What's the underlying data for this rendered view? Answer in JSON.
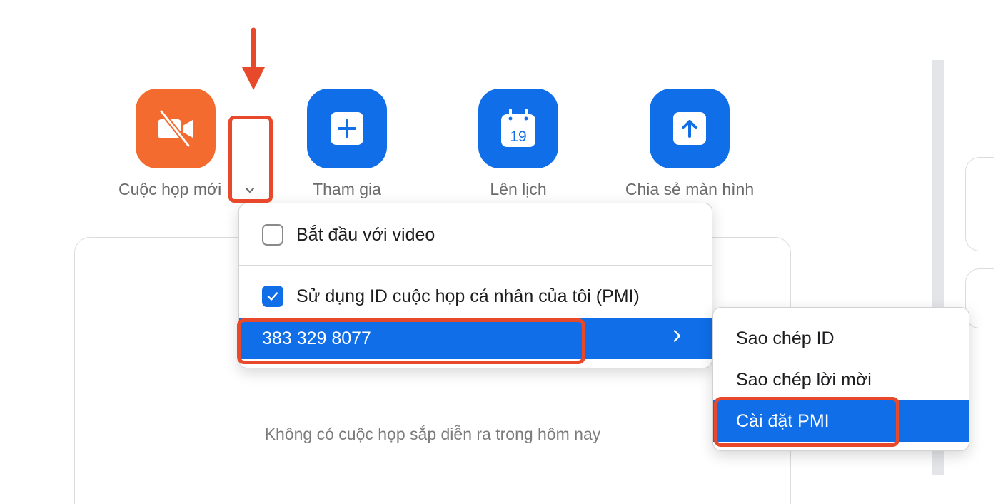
{
  "actions": [
    {
      "id": "new-meeting",
      "label": "Cuộc họp mới",
      "icon": "video-off-icon",
      "color": "#f46b2f"
    },
    {
      "id": "join",
      "label": "Tham gia",
      "icon": "plus-icon",
      "color": "#0f6ee8"
    },
    {
      "id": "schedule",
      "label": "Lên lịch",
      "icon": "calendar-icon",
      "calendar_day": "19",
      "color": "#0f6ee8"
    },
    {
      "id": "share-screen",
      "label": "Chia sẻ màn hình",
      "icon": "upload-icon",
      "color": "#0f6ee8"
    }
  ],
  "meetings_card": {
    "empty_text": "Không có cuộc họp sắp diễn ra trong hôm nay"
  },
  "dropdown": {
    "items": [
      {
        "label": "Bắt đầu với video",
        "checked": false
      },
      {
        "label": "Sử dụng ID cuộc họp cá nhân của tôi (PMI)",
        "checked": true
      }
    ],
    "pmi_number": "383 329 8077"
  },
  "submenu": {
    "items": [
      {
        "label": "Sao chép ID"
      },
      {
        "label": "Sao chép lời mời"
      },
      {
        "label": "Cài đặt PMI",
        "selected": true
      }
    ]
  },
  "colors": {
    "accent_blue": "#0f6ee8",
    "accent_orange": "#f46b2f",
    "annotation_red": "#e8492a"
  }
}
